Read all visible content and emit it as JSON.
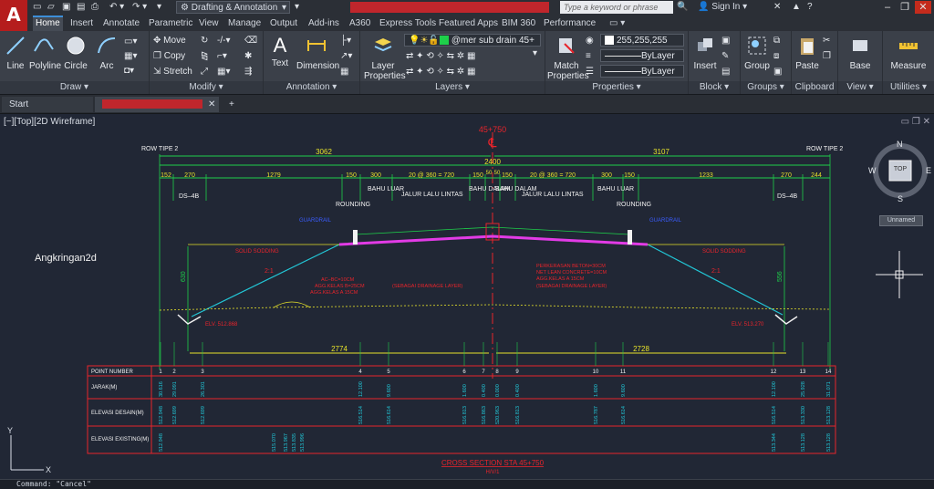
{
  "app": {
    "logo": "A",
    "workspace": "Drafting & Annotation",
    "search_placeholder": "Type a keyword or phrase",
    "sign_in": "Sign In",
    "win_min": "–",
    "win_max": "❐",
    "win_close": "✕"
  },
  "menu_tabs": [
    "Home",
    "Insert",
    "Annotate",
    "Parametric",
    "View",
    "Manage",
    "Output",
    "Add-ins",
    "A360",
    "Express Tools",
    "Featured Apps",
    "BIM 360",
    "Performance"
  ],
  "ribbon": {
    "draw": {
      "title": "Draw ▾",
      "line": "Line",
      "polyline": "Polyline",
      "circle": "Circle",
      "arc": "Arc"
    },
    "modify": {
      "title": "Modify ▾",
      "move": "Move",
      "copy": "Copy",
      "stretch": "Stretch"
    },
    "annotation": {
      "title": "Annotation ▾",
      "text": "Text",
      "dimension": "Dimension"
    },
    "layers": {
      "title": "Layers ▾",
      "layer_properties": "Layer Properties",
      "current_layer": "@mer sub drain 45+"
    },
    "properties": {
      "title": "Properties ▾",
      "match": "Match Properties",
      "color": "255,255,255",
      "linetype": "ByLayer",
      "lineweight": "ByLayer"
    },
    "block": {
      "title": "Block ▾",
      "insert": "Insert"
    },
    "groups": {
      "title": "Groups ▾",
      "group": "Group"
    },
    "clipboard": {
      "title": "Clipboard",
      "paste": "Paste"
    },
    "view": {
      "title": "View ▾",
      "base": "Base"
    },
    "utilities": {
      "title": "Utilities ▾",
      "measure": "Measure"
    }
  },
  "doc_tabs": {
    "start": "Start",
    "add": "+"
  },
  "viewport": {
    "label": "[−][Top][2D Wireframe]",
    "watermark": "Angkringan2d",
    "viewcube": {
      "n": "N",
      "s": "S",
      "e": "E",
      "w": "W",
      "top": "TOP",
      "unnamed": "Unnamed"
    }
  },
  "drawing": {
    "station_top": "45+750",
    "cl": "℄",
    "row_left": "ROW TIPE 2",
    "row_right": "ROW TIPE 2",
    "dim_left_total": "3062",
    "dim_right_total": "3107",
    "dim_center": "2400",
    "dims_left": [
      "152",
      "270",
      "1279",
      "150",
      "300",
      "20 @ 360 = 720",
      "150",
      "50"
    ],
    "dims_right": [
      "50",
      "150",
      "20 @ 360 = 720",
      "300",
      "150",
      "1233",
      "270",
      "244"
    ],
    "labels_top": [
      "DS–4B",
      "ROUNDING",
      "BAHU LUAR",
      "JALUR LALU LINTAS",
      "BAHU DALAM",
      "BAHU DALAM",
      "JALUR LALU LINTAS",
      "BAHU LUAR",
      "ROUNDING",
      "DS–4B"
    ],
    "guardrail": "GUARDRAIL",
    "solid_sodding": "SOLID SODDING",
    "slope": "2:1",
    "layer_notes_left": [
      "AC–BC=10CM",
      "AGG.KELAS B=25CM",
      "AGG.KELAS A 15CM",
      "(SEBAGAI DRAINAGE LAYER)"
    ],
    "layer_notes_right": [
      "PERKERASAN BETON=30CM",
      "NET LEAN CONCRETE=10CM",
      "AGG.KELAS A 15CM",
      "(SEBAGAI DRAINAGE LAYER)"
    ],
    "elev_left": "ELV. 512.868",
    "elev_right": "ELV. 513.270",
    "dim_bottom_left": "2774",
    "dim_bottom_right": "2728",
    "side_dim_left": "630",
    "side_dim_right": "556",
    "table_rows": [
      "POINT NUMBER",
      "JARAK(M)",
      "ELEVASI DESAIN(M)",
      "ELEVASI EXISTING(M)"
    ],
    "point_numbers": [
      "1",
      "2",
      "3",
      "4",
      "5",
      "6",
      "7",
      "8",
      "9",
      "10",
      "11",
      "12",
      "13",
      "14"
    ],
    "jarak": [
      "30.616",
      "29.091",
      "26.301",
      "12.100",
      "9.600",
      "1.600",
      "0.400",
      "0.000",
      "0.400",
      "1.600",
      "9.600",
      "12.100",
      "25.928",
      "31.071"
    ],
    "elev_desain": [
      "512.948",
      "512.699",
      "512.699",
      "516.514",
      "516.614",
      "516.813",
      "516.863",
      "520.963",
      "516.813",
      "516.787",
      "516.614",
      "516.514",
      "513.330",
      "513.128"
    ],
    "elev_existing": [
      "512.948",
      "",
      "",
      "",
      "",
      "",
      "",
      "",
      "",
      "",
      "",
      "513.344",
      "513.128",
      "513.128"
    ],
    "existing_mid": [
      "515.070",
      "513.967",
      "513.835",
      "513.996"
    ],
    "section_title": "CROSS   SECTION STA 45+750",
    "section_scale": "H/V/1"
  },
  "command_line": "Command: \"Cancel\"",
  "colors": {
    "canvas": "#212735",
    "green": "#1ecf4a",
    "yellow": "#e6e22a",
    "red": "#e8242b",
    "cyan": "#22c6d6",
    "magenta": "#e23be6",
    "blue": "#3a5cff",
    "white": "#f2f2f2"
  }
}
